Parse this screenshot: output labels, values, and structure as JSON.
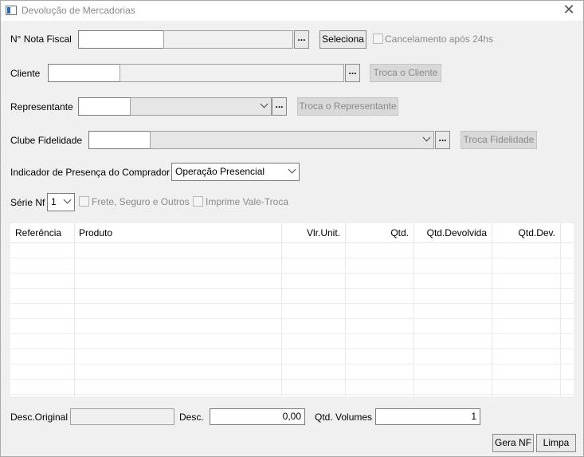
{
  "window": {
    "title": "Devolução de Mercadorias",
    "close_icon": "close-icon"
  },
  "nota_fiscal": {
    "label": "N° Nota Fiscal",
    "number_value": "",
    "description_value": "",
    "browse_label": "...",
    "select_label": "Seleciona",
    "cancel_24h_label": "Cancelamento após 24hs"
  },
  "cliente": {
    "label": "Cliente",
    "code_value": "",
    "name_value": "",
    "browse_label": "...",
    "change_label": "Troca o Cliente"
  },
  "representante": {
    "label": "Representante",
    "code_value": "",
    "selected_value": "",
    "browse_label": "...",
    "change_label": "Troca o Representante"
  },
  "clube_fidelidade": {
    "label": "Clube Fidelidade",
    "code_value": "",
    "selected_value": "",
    "browse_label": "...",
    "change_label": "Troca Fidelidade"
  },
  "indicador_presenca": {
    "label": "Indicador de Presença do Comprador",
    "selected_value": "Operação Presencial"
  },
  "serie": {
    "label": "Série Nf",
    "selected_value": "1",
    "frete_label": "Frete, Seguro e Outros",
    "vale_troca_label": "Imprime Vale-Troca"
  },
  "grid": {
    "columns": [
      "Referência",
      "Produto",
      "Vlr.Unit.",
      "Qtd.",
      "Qtd.Devolvida",
      "Qtd.Dev."
    ],
    "rows": []
  },
  "footer": {
    "desc_original_label": "Desc.Original",
    "desc_original_value": "",
    "desc_label": "Desc.",
    "desc_value": "0,00",
    "volumes_label": "Qtd. Volumes",
    "volumes_value": "1",
    "gera_nf_label": "Gera NF",
    "limpa_label": "Limpa"
  }
}
